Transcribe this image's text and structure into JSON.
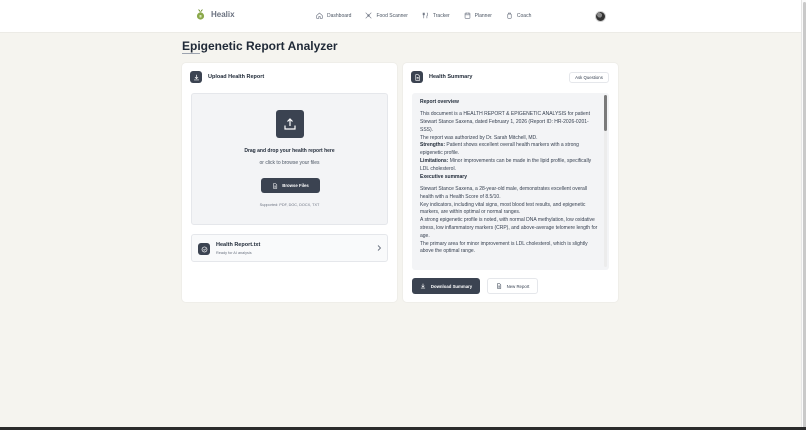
{
  "nav": {
    "brand": "Healix",
    "links": [
      {
        "label": "Dashboard",
        "icon": "home-icon"
      },
      {
        "label": "Food Scanner",
        "icon": "scan-icon"
      },
      {
        "label": "Tracker",
        "icon": "utensils-icon"
      },
      {
        "label": "Planner",
        "icon": "calendar-icon"
      },
      {
        "label": "Coach",
        "icon": "coach-icon"
      }
    ]
  },
  "page": {
    "title": "Epigenetic Report Analyzer"
  },
  "upload": {
    "title": "Upload Health Report",
    "drop_main": "Drag and drop your health report here",
    "drop_sub": "or click to browse your files",
    "browse_label": "Browse Files",
    "supported": "Supported: PDF, DOC, DOCX, TXT",
    "file": {
      "name": "Health Report.txt",
      "status": "Ready for AI analysis"
    }
  },
  "summary": {
    "title": "Health Summary",
    "ask_label": "Ask Questions",
    "overview_heading": "Report overview",
    "overview_p1": "This document is a HEALTH REPORT & EPIGENETIC ANALYSIS for patient Stewart Stance Saxena, dated February 1, 2026 (Report ID: HR-2026-0201-SSS).",
    "overview_p2": "The report was authorized by Dr. Sarah Mitchell, MD.",
    "strengths_label": "Strengths:",
    "strengths_text": " Patient shows excellent overall health markers with a strong epigenetic profile.",
    "limitations_label": "Limitations:",
    "limitations_text": " Minor improvements can be made in the lipid profile, specifically LDL cholesterol.",
    "exec_heading": "Executive summary",
    "exec_p1": "Stewart Stance Saxena, a 28-year-old male, demonstrates excellent overall health with a Health Score of 8.5/10.",
    "exec_p2": "Key indicators, including vital signs, most blood test results, and epigenetic markers, are within optimal or normal ranges.",
    "exec_p3": "A strong epigenetic profile is noted, with normal DNA methylation, low oxidative stress, low inflammatory markers (CRP), and above-average telomere length for age.",
    "exec_p4": "The primary area for minor improvement is LDL cholesterol, which is slightly above the optimal range.",
    "download_label": "Download Summary",
    "new_label": "New Report"
  },
  "colors": {
    "accent": "#3b4351",
    "background": "#f5f4ef",
    "brand_green": "#8aa84a"
  }
}
